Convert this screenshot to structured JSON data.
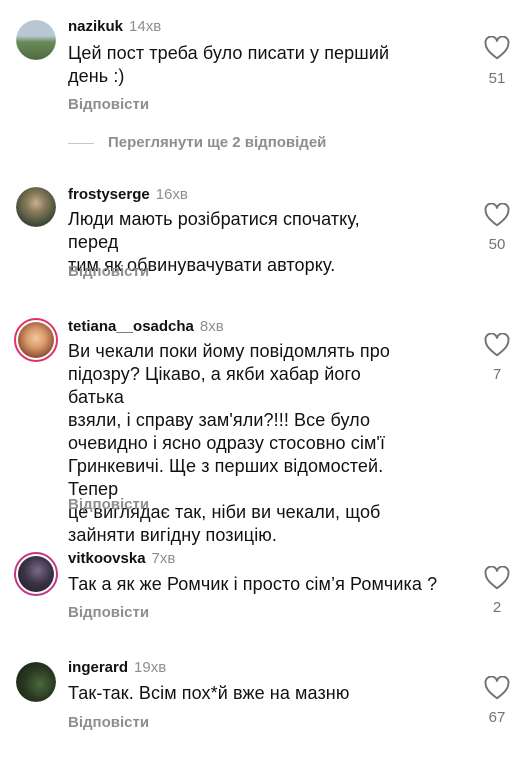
{
  "comments": [
    {
      "username": "nazikuk",
      "time": "14хв",
      "text": "Цей пост треба було писати у перший\nдень :)",
      "reply_label": "Відповісти",
      "likes": "51",
      "avatar_color": "#6b8a5a",
      "has_story": false
    },
    {
      "username": "frostyserge",
      "time": "16хв",
      "text": "Люди мають розібратися спочатку, перед\nтим як обвинувачувати авторку.",
      "reply_label": "Відповісти",
      "likes": "50",
      "avatar_color": "#4e5a48",
      "has_story": false
    },
    {
      "username": "tetiana__osadcha",
      "time": "8хв",
      "text": "Ви чекали поки йому повідомлять про\nпідозру? Цікаво, а якби хабар його батька\nвзяли, і справу зам'яли?!!! Все було\nочевидно і ясно одразу стосовно сім'ї\nГринкевичі. Ще з перших відомостей. Тепер\nце виглядає так, ніби ви чекали, щоб\nзайняти вигідну позицію.",
      "reply_label": "Відповісти",
      "likes": "7",
      "avatar_color": "#c98a5e",
      "has_story": true
    },
    {
      "username": "vitkoovska",
      "time": "7хв",
      "text": "Так а як же Ромчик і просто сім’я Ромчика ?",
      "reply_label": "Відповісти",
      "likes": "2",
      "avatar_color": "#2d2a35",
      "has_story": true
    },
    {
      "username": "ingerard",
      "time": "19хв",
      "text": "Так-так. Всім пох*й вже на мазню",
      "reply_label": "Відповісти",
      "likes": "67",
      "avatar_color": "#1f2a1c",
      "has_story": false
    }
  ],
  "view_more_replies": "Переглянути ще 2 відповідей"
}
